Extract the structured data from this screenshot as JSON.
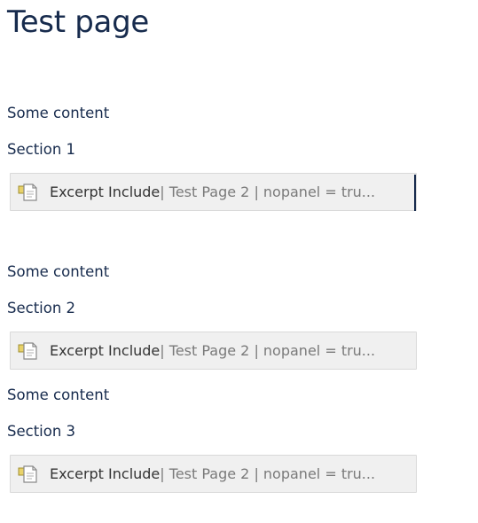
{
  "page": {
    "title": "Test page"
  },
  "blocks": [
    {
      "content_text": "Some content",
      "section_text": "Section 1",
      "macro": {
        "name": "Excerpt Include",
        "params": " | Test Page 2 | nopanel = tru...",
        "icon": "document-excerpt-icon"
      }
    },
    {
      "content_text": "Some content",
      "section_text": "Section 2",
      "macro": {
        "name": "Excerpt Include",
        "params": " | Test Page 2 | nopanel = tru...",
        "icon": "document-excerpt-icon"
      }
    },
    {
      "content_text": "Some content",
      "section_text": "Section 3",
      "macro": {
        "name": "Excerpt Include",
        "params": " | Test Page 2 | nopanel = tru...",
        "icon": "document-excerpt-icon"
      }
    }
  ],
  "colors": {
    "text": "#172b4d",
    "macro_background": "#f0f0f0",
    "macro_border": "#d9d9d9",
    "macro_params": "#7a7a7a"
  }
}
